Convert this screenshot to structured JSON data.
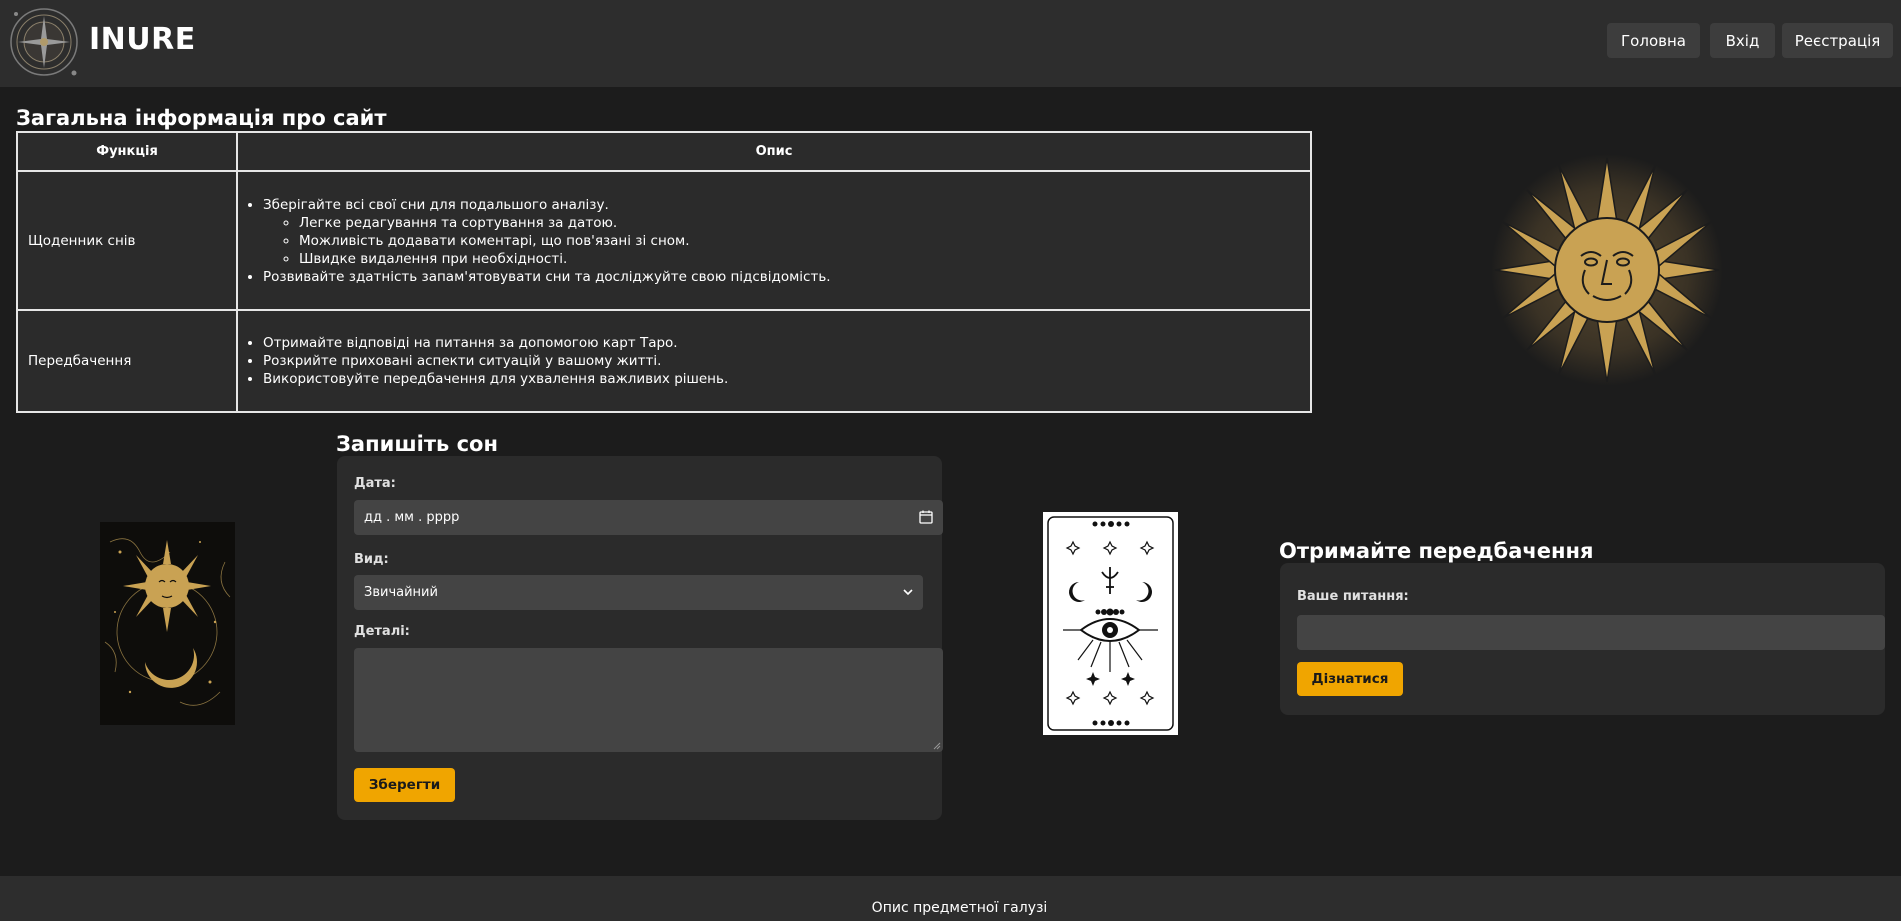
{
  "header": {
    "brand": "INURE",
    "nav": {
      "home": "Головна",
      "login": "Вхід",
      "register": "Реєстрація"
    }
  },
  "info": {
    "title": "Загальна інформація про сайт",
    "columns": [
      "Функція",
      "Опис"
    ],
    "rows": [
      {
        "function": "Щоденник снів",
        "items": [
          "Зберігайте всі свої сни для подальшого аналізу.",
          "Розвивайте здатність запам'ятовувати сни та досліджуйте свою підсвідомість."
        ],
        "subitems": [
          "Легке редагування та сортування за датою.",
          "Можливість додавати коментарі, що пов'язані зі сном.",
          "Швидке видалення при необхідності."
        ]
      },
      {
        "function": "Передбачення",
        "items": [
          "Отримайте відповіді на питання за допомогою карт Таро.",
          "Розкрийте приховані аспекти ситуацій у вашому житті.",
          "Використовуйте передбачення для ухвалення важливих рішень."
        ]
      }
    ]
  },
  "dream_form": {
    "title": "Запишіть сон",
    "date_label": "Дата:",
    "date_placeholder": "дд . мм . рррр",
    "type_label": "Вид:",
    "type_value": "Звичайний",
    "details_label": "Деталі:",
    "save_label": "Зберегти"
  },
  "prediction_form": {
    "title": "Отримайте передбачення",
    "question_label": "Ваше питання:",
    "submit_label": "Дізнатися"
  },
  "footer": {
    "text": "Опис предметної галузі"
  },
  "colors": {
    "background": "#1c1c1c",
    "header": "#2d2d2d",
    "panel": "#2b2b2b",
    "field": "#444444",
    "accent": "#f0a500",
    "gold": "#c9a253"
  }
}
